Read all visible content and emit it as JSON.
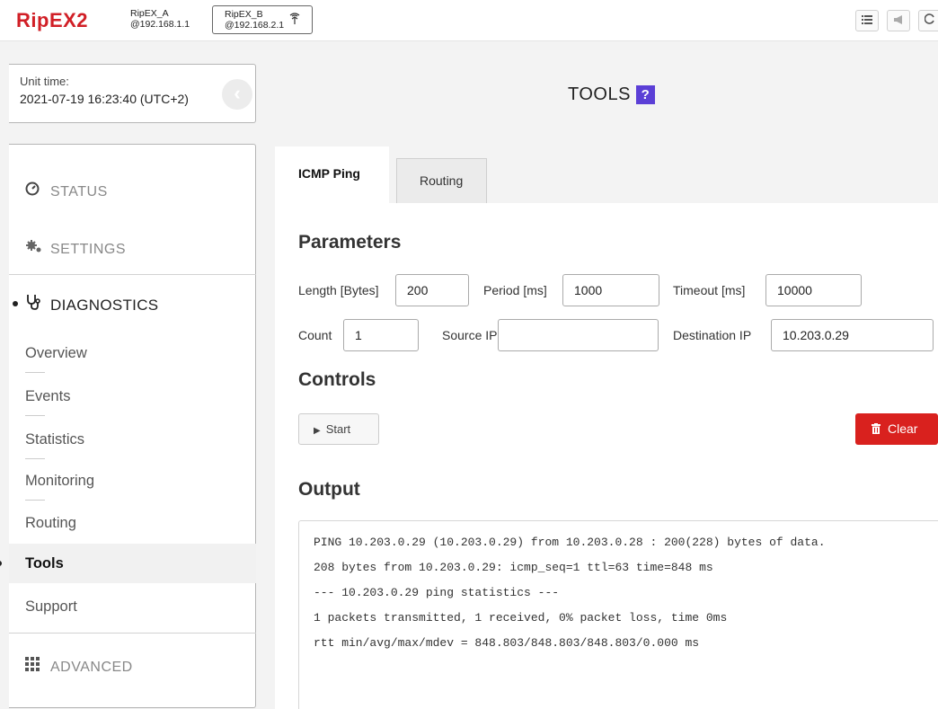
{
  "header": {
    "logo": "RipEX2",
    "unit_a": {
      "name": "RipEX_A",
      "ip": "@192.168.1.1"
    },
    "unit_b": {
      "name": "RipEX_B",
      "ip": "@192.168.2.1",
      "icon": "antenna-icon"
    },
    "buttons": [
      {
        "icon": "list-icon",
        "glyph": "☰"
      },
      {
        "icon": "megaphone-icon",
        "glyph": "📢"
      },
      {
        "icon": "refresh-icon",
        "glyph": "↻"
      }
    ]
  },
  "unit_time": {
    "label": "Unit time:",
    "value": "2021-07-19 16:23:40 (UTC+2)"
  },
  "sidebar": {
    "status": "STATUS",
    "settings": "SETTINGS",
    "diagnostics": "DIAGNOSTICS",
    "items": [
      "Overview",
      "Events",
      "Statistics",
      "Monitoring",
      "Routing",
      "Tools",
      "Support"
    ],
    "active_item": "Tools",
    "advanced": "ADVANCED"
  },
  "page": {
    "title": "TOOLS",
    "help": "?"
  },
  "tabs": {
    "active": "ICMP Ping",
    "inactive": "Routing"
  },
  "parameters": {
    "heading": "Parameters",
    "length_label": "Length [Bytes]",
    "length": "200",
    "period_label": "Period [ms]",
    "period": "1000",
    "timeout_label": "Timeout [ms]",
    "timeout": "10000",
    "count_label": "Count",
    "count": "1",
    "source_label": "Source IP",
    "source": "",
    "dest_label": "Destination IP",
    "dest": "10.203.0.29"
  },
  "controls": {
    "heading": "Controls",
    "start": "Start",
    "clear": "Clear"
  },
  "output": {
    "heading": "Output",
    "lines": [
      "PING 10.203.0.29 (10.203.0.29) from 10.203.0.28 : 200(228) bytes of data.",
      "208 bytes from 10.203.0.29: icmp_seq=1 ttl=63 time=848 ms",
      "--- 10.203.0.29 ping statistics ---",
      "1 packets transmitted, 1 received, 0% packet loss, time 0ms",
      "rtt min/avg/max/mdev = 848.803/848.803/848.803/0.000 ms"
    ]
  },
  "colors": {
    "brand": "#d11f26",
    "help": "#5b3fd6",
    "clear": "#d9211e"
  }
}
